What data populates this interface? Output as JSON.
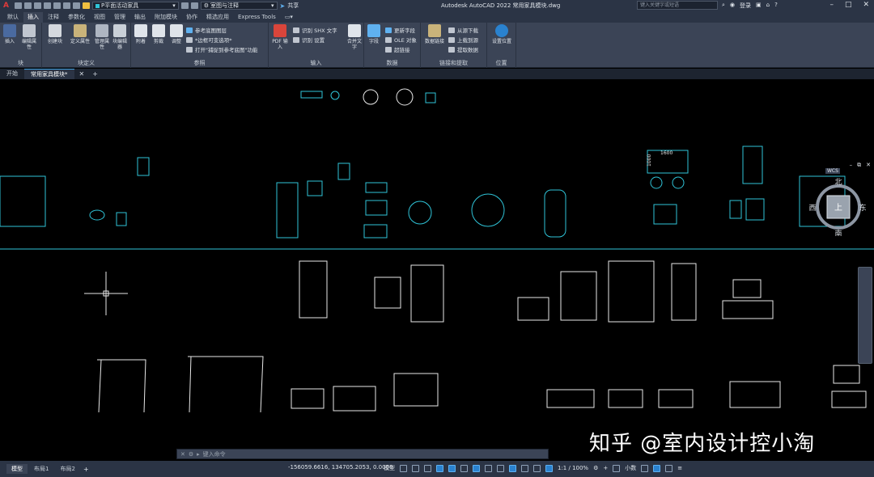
{
  "title_bar": {
    "logo": "A",
    "layer_dropdown": "P平面活动家具",
    "annotation_dropdown": "室图与注释",
    "share_label": "共享",
    "app_title": "Autodesk AutoCAD 2022    常用家具模块.dwg",
    "search_placeholder": "键入关键字或短语",
    "login_label": "登录"
  },
  "ribbon_tabs": [
    "默认",
    "插入",
    "注释",
    "参数化",
    "视图",
    "管理",
    "输出",
    "附加模块",
    "协作",
    "精选应用",
    "Express Tools"
  ],
  "active_tab": "插入",
  "ribbon": {
    "block_panel": {
      "title": "块",
      "insert": "插入",
      "edit_attr": "编辑属性"
    },
    "block_def_panel": {
      "title": "块定义",
      "create": "创建块",
      "define_attr": "定义属性",
      "manage_attr": "管理属性",
      "block_editor": "块编辑器"
    },
    "reference_panel": {
      "title": "参照",
      "attach": "附着",
      "clip": "剪裁",
      "adjust": "调整",
      "underlay_layers": "参考底图图层",
      "frames": "*边框可变选项*",
      "snap": "打开\"捕捉到参考底图\"功能"
    },
    "import_panel": {
      "title": "输入",
      "pdf_import": "PDF 输入",
      "shx": "识别 SHX 文字",
      "recognize_settings": "识别 设置",
      "combine_text": "合并文字"
    },
    "data_panel": {
      "title": "数据",
      "field": "字段",
      "update_fields": "更新字段",
      "ole": "OLE 对象",
      "hyperlink": "超链接"
    },
    "link_panel": {
      "title": "链接和提取",
      "data_link": "数据链接",
      "download": "从源下载",
      "upload": "上载到源",
      "extract": "提取数据"
    },
    "location_panel": {
      "title": "位置",
      "set_location": "设置位置"
    }
  },
  "doc_tabs": [
    "开始",
    "常用家具模块*"
  ],
  "active_doc_tab": "常用家具模块*",
  "viewcube": {
    "north": "北",
    "south": "南",
    "east": "东",
    "west": "西",
    "top": "上",
    "wcs": "WCS"
  },
  "drawing": {
    "dim_width": "1600",
    "dim_height": "1000"
  },
  "command_line": {
    "placeholder": "键入命令"
  },
  "layout_tabs": [
    "模型",
    "布局1",
    "布局2"
  ],
  "active_layout": "模型",
  "status": {
    "coords": "-156059.6616, 134705.2053, 0.0000",
    "model_label": "模型",
    "scale": "1:1 / 100%",
    "units": "小数"
  },
  "watermark": "知乎 @室内设计控小淘",
  "colors": {
    "accent": "#2a82cf",
    "cyan_lines": "#2fc4d8",
    "white_lines": "#e8e8e8",
    "ribbon_bg": "#3b4456"
  }
}
